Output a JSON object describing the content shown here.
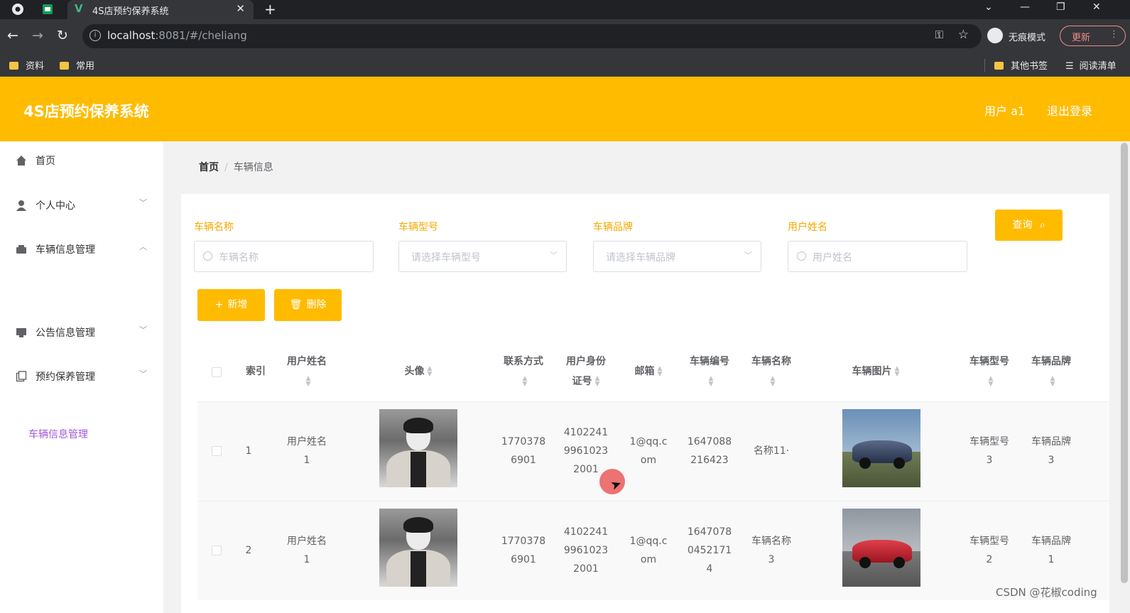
{
  "browser": {
    "tab_title": "4S店预约保养系统",
    "tab_logo": "V",
    "new_tab": "+",
    "url_host": "localhost",
    "url_path": ":8081/#/cheliang",
    "incognito_label": "无痕模式",
    "update_label": "更新",
    "bookmarks": [
      "资料",
      "常用"
    ],
    "bookmarks_right": [
      "其他书签",
      "阅读清单"
    ]
  },
  "header": {
    "title": "4S店预约保养系统",
    "user": "用户 a1",
    "logout": "退出登录"
  },
  "sidebar": {
    "items": [
      {
        "label": "首页",
        "icon": "home-icon"
      },
      {
        "label": "个人中心",
        "icon": "user-icon"
      },
      {
        "label": "车辆信息管理",
        "icon": "vehicle-icon"
      },
      {
        "label": "公告信息管理",
        "icon": "notice-icon"
      },
      {
        "label": "预约保养管理",
        "icon": "booking-icon"
      }
    ],
    "active_sub": "车辆信息管理"
  },
  "breadcrumb": {
    "home": "首页",
    "current": "车辆信息"
  },
  "filters": {
    "name_label": "车辆名称",
    "name_placeholder": "车辆名称",
    "model_label": "车辆型号",
    "model_placeholder": "请选择车辆型号",
    "brand_label": "车辆品牌",
    "brand_placeholder": "请选择车辆品牌",
    "user_label": "用户姓名",
    "user_placeholder": "用户姓名",
    "query": "查询"
  },
  "actions": {
    "add": "新增",
    "delete": "删除"
  },
  "table": {
    "headers": {
      "index": "索引",
      "user_name": "用户姓名",
      "avatar": "头像",
      "phone": "联系方式",
      "id_card_1": "用户身份",
      "id_card_2": "证号",
      "email": "邮箱",
      "car_no": "车辆编号",
      "car_name": "车辆名称",
      "car_img": "车辆图片",
      "car_model": "车辆型号",
      "car_brand": "车辆品牌"
    },
    "rows": [
      {
        "index": "1",
        "user_1": "用户姓名",
        "user_2": "1",
        "phone_1": "1770378",
        "phone_2": "6901",
        "id_1": "4102241",
        "id_2": "9961023",
        "id_3": "2001",
        "email_1": "1@qq.c",
        "email_2": "om",
        "no_1": "1647088",
        "no_2": "216423",
        "no_3": "",
        "car_1": "名称11·",
        "car_2": "",
        "model_1": "车辆型号",
        "model_2": "3",
        "brand_1": "车辆品牌",
        "brand_2": "3"
      },
      {
        "index": "2",
        "user_1": "用户姓名",
        "user_2": "1",
        "phone_1": "1770378",
        "phone_2": "6901",
        "id_1": "4102241",
        "id_2": "9961023",
        "id_3": "2001",
        "email_1": "1@qq.c",
        "email_2": "om",
        "no_1": "1647078",
        "no_2": "0452171",
        "no_3": "4",
        "car_1": "车辆名称",
        "car_2": "3",
        "model_1": "车辆型号",
        "model_2": "2",
        "brand_1": "车辆品牌",
        "brand_2": "1"
      }
    ]
  },
  "watermark": "CSDN @花椒coding",
  "colors": {
    "accent": "#ffbb00",
    "active_menu": "#a259d6",
    "filter_label": "#f7a800"
  }
}
